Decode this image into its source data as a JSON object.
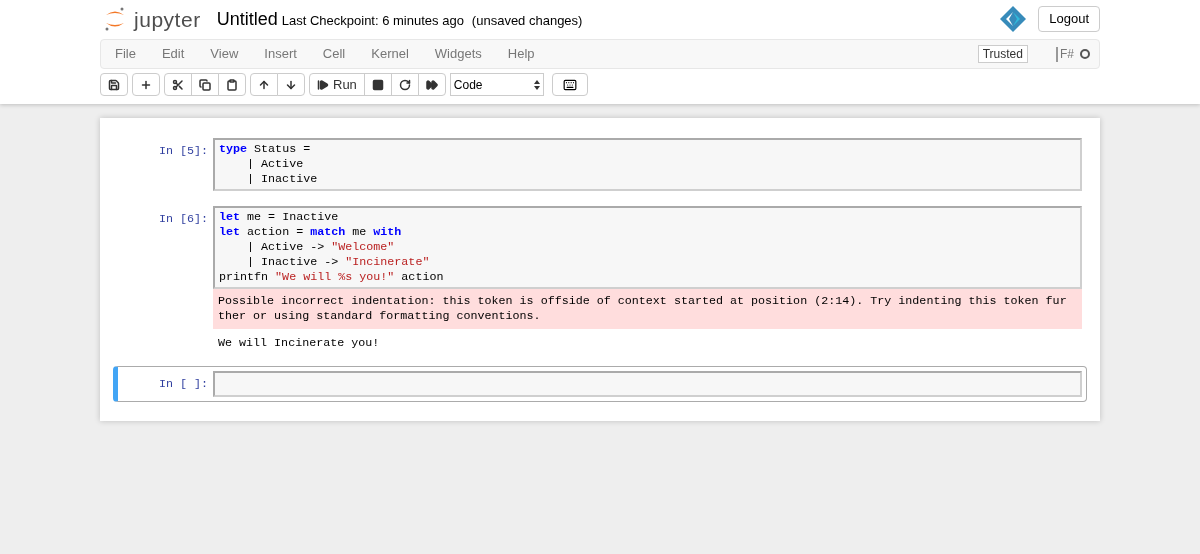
{
  "header": {
    "logo_text": "jupyter",
    "notebook_name": "Untitled",
    "checkpoint": "Last Checkpoint: 6 minutes ago",
    "autosave": "(unsaved changes)",
    "logout": "Logout"
  },
  "menubar": {
    "items": [
      "File",
      "Edit",
      "View",
      "Insert",
      "Cell",
      "Kernel",
      "Widgets",
      "Help"
    ],
    "trusted": "Trusted",
    "kernel_name": "F#",
    "kernel_busy": false
  },
  "toolbar": {
    "groups": [
      [
        {
          "kind": "save"
        }
      ],
      [
        {
          "kind": "add"
        }
      ],
      [
        {
          "kind": "cut"
        },
        {
          "kind": "copy"
        },
        {
          "kind": "paste"
        }
      ],
      [
        {
          "kind": "up"
        },
        {
          "kind": "down"
        }
      ],
      [
        {
          "kind": "run",
          "label": "Run"
        },
        {
          "kind": "stop"
        },
        {
          "kind": "restart"
        },
        {
          "kind": "fastforward"
        }
      ]
    ],
    "cell_type": "Code"
  },
  "cells": [
    {
      "prompt": "In [5]:",
      "selected": false,
      "lines": [
        [
          {
            "kind": "keyword",
            "text": "type"
          },
          {
            "kind": "plain",
            "text": " Status ="
          }
        ],
        [
          {
            "kind": "plain",
            "text": "    | Active"
          }
        ],
        [
          {
            "kind": "plain",
            "text": "    | Inactive"
          }
        ]
      ]
    },
    {
      "prompt": "In [6]:",
      "selected": false,
      "lines": [
        [
          {
            "kind": "keyword",
            "text": "let"
          },
          {
            "kind": "plain",
            "text": " me = Inactive"
          }
        ],
        [
          {
            "kind": "keyword",
            "text": "let"
          },
          {
            "kind": "plain",
            "text": " action = "
          },
          {
            "kind": "keyword",
            "text": "match"
          },
          {
            "kind": "plain",
            "text": " me "
          },
          {
            "kind": "keyword",
            "text": "with"
          }
        ],
        [
          {
            "kind": "plain",
            "text": "    | Active -> "
          },
          {
            "kind": "string",
            "text": "\"Welcome\""
          }
        ],
        [
          {
            "kind": "plain",
            "text": "    | Inactive -> "
          },
          {
            "kind": "string",
            "text": "\"Incinerate\""
          }
        ],
        [
          {
            "kind": "plain",
            "text": "printfn "
          },
          {
            "kind": "string",
            "text": "\"We will %s you!\""
          },
          {
            "kind": "plain",
            "text": " action"
          }
        ]
      ],
      "outputs": [
        {
          "kind": "error",
          "lines": [
            "Possible incorrect indentation: this token is offside of context started at position (2:14). Try indenting this token fur",
            "ther or using standard formatting conventions."
          ]
        },
        {
          "kind": "stream",
          "lines": [
            "We will Incinerate you!"
          ]
        }
      ]
    },
    {
      "prompt": "In [ ]:",
      "selected": true
    }
  ]
}
